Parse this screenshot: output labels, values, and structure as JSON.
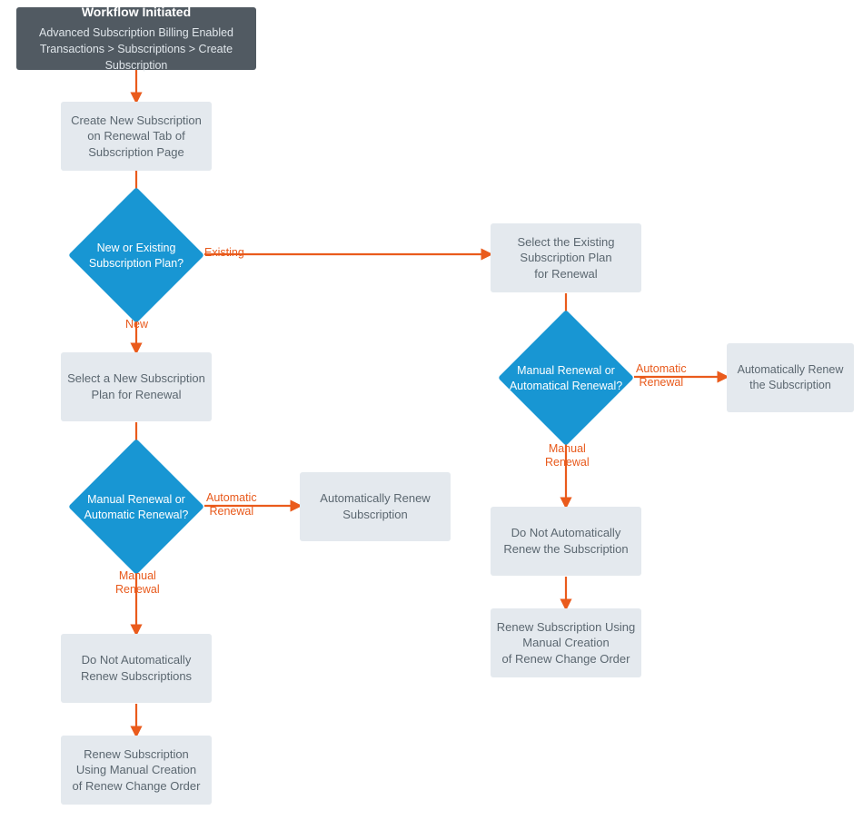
{
  "colors": {
    "process_bg": "#e4e9ee",
    "decision_bg": "#1896d3",
    "start_bg": "#515a62",
    "connector": "#ea5b1c",
    "text": "#5b6770",
    "decision_text": "#ffffff"
  },
  "start": {
    "title": "Workflow Initiated",
    "line1": "Advanced Subscription Billing Enabled",
    "line2": "Transactions > Subscriptions > Create Subscription"
  },
  "nodes": {
    "create_sub": "Create New Subscription\non Renewal Tab of\nSubscription Page",
    "d_new_exist": "New or Existing\nSubscription Plan?",
    "select_new": "Select a New Subscription\nPlan for Renewal",
    "d_renewal_left": "Manual Renewal or\nAutomatic Renewal?",
    "auto_left": "Automatically Renew\nSubscription",
    "no_auto_left": "Do Not Automatically\nRenew Subscriptions",
    "manual_left": "Renew Subscription\nUsing Manual Creation\nof Renew Change Order",
    "select_existing": "Select the Existing\nSubscription Plan\nfor Renewal",
    "d_renewal_right": "Manual Renewal or\nAutomatical Renewal?",
    "auto_right": "Automatically Renew\nthe Subscription",
    "no_auto_right": "Do Not Automatically\nRenew the Subscription",
    "manual_right": "Renew Subscription Using\nManual Creation\nof Renew Change Order"
  },
  "edges": {
    "new": "New",
    "existing": "Existing",
    "auto": "Automatic\nRenewal",
    "manual": "Manual\nRenewal"
  }
}
